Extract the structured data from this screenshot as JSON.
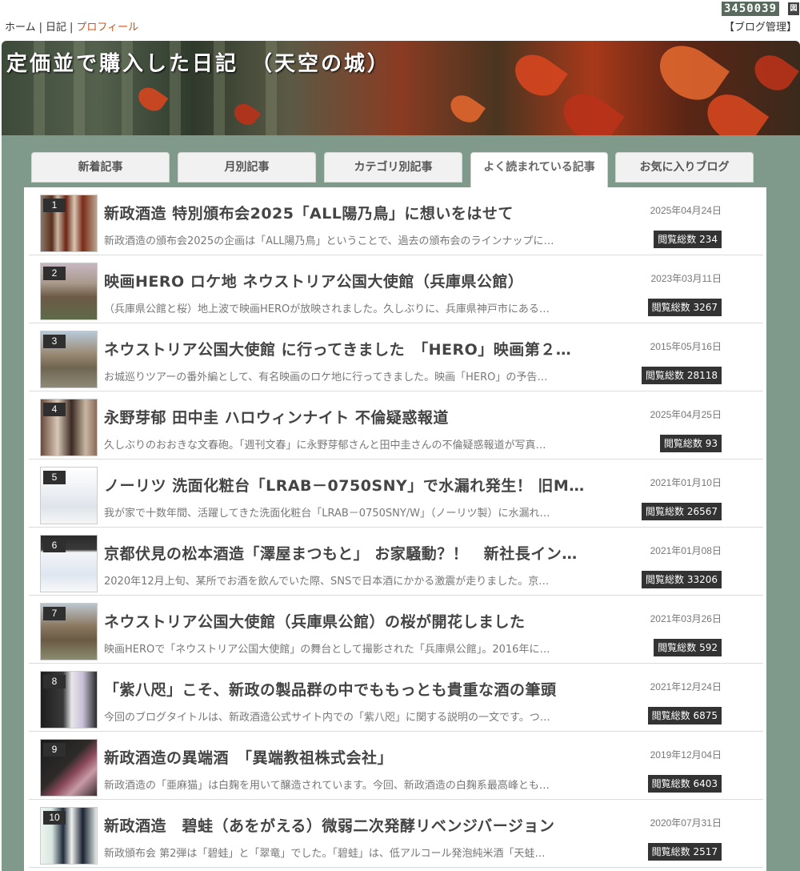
{
  "counter": {
    "value": "3450039",
    "icon": "calendar-icon",
    "icon_glyph": "図"
  },
  "nav": {
    "home": "ホーム",
    "diary": "日記",
    "profile": "プロフィール",
    "sep": "|",
    "admin": "【ブログ管理】"
  },
  "header": {
    "title": "定価並で購入した日記　（天空の城）"
  },
  "tabs": [
    "新着記事",
    "月別記事",
    "カテゴリ別記事",
    "よく読まれている記事",
    "お気に入りブログ"
  ],
  "active_tab": 3,
  "colors": {
    "accent": "#c8541a",
    "panel_bg": "#7f9a8b",
    "badge_bg": "#333333"
  },
  "articles": [
    {
      "rank": "1",
      "title": "新政酒造 特別頒布会2025「ALL陽乃鳥」に想いをはせて",
      "excerpt": "新政酒造の頒布会2025の企画は「ALL陽乃鳥」ということで、過去の頒布会のラインナップに…",
      "date": "2025年04月24日",
      "views": "閲覧総数 234"
    },
    {
      "rank": "2",
      "title": "映画HERO ロケ地 ネウストリア公国大使館（兵庫県公館）",
      "excerpt": "（兵庫県公館と桜）地上波で映画HEROが放映されました。久しぶりに、兵庫県神戸市にある…",
      "date": "2023年03月11日",
      "views": "閲覧総数 3267"
    },
    {
      "rank": "3",
      "title": "ネウストリア公国大使館 に行ってきました　「HERO」映画第２…",
      "excerpt": "お城巡りツアーの番外編として、有名映画のロケ地に行ってきました。映画「HERO」の予告…",
      "date": "2015年05月16日",
      "views": "閲覧総数 28118"
    },
    {
      "rank": "4",
      "title": "永野芽郁 田中圭 ハロウィンナイト 不倫疑惑報道",
      "excerpt": "久しぶりのおおきな文春砲。「週刊文春」に永野芽郁さんと田中圭さんの不倫疑惑報道が写真…",
      "date": "2025年04月25日",
      "views": "閲覧総数 93"
    },
    {
      "rank": "5",
      "title": "ノーリツ 洗面化粧台「LRAB－0750SNY」で水漏れ発生！ 旧M…",
      "excerpt": "我が家で十数年間、活躍してきた洗面化粧台「LRAB－0750SNY/W」（ノーリツ製）に水漏れ…",
      "date": "2021年01月10日",
      "views": "閲覧総数 26567"
    },
    {
      "rank": "6",
      "title": "京都伏見の松本酒造「澤屋まつもと」 お家騒動？！　新社長イン…",
      "excerpt": "2020年12月上旬、某所でお酒を飲んでいた際、SNSで日本酒にかかる激震が走りました。京…",
      "date": "2021年01月08日",
      "views": "閲覧総数 33206"
    },
    {
      "rank": "7",
      "title": "ネウストリア公国大使館（兵庫県公館）の桜が開花しました",
      "excerpt": "映画HEROで「ネウストリア公国大使館」の舞台として撮影された「兵庫県公館」。2016年に…",
      "date": "2021年03月26日",
      "views": "閲覧総数 592"
    },
    {
      "rank": "8",
      "title": "「紫八咫」こそ、新政の製品群の中でももっとも貴重な酒の筆頭",
      "excerpt": "今回のブログタイトルは、新政酒造公式サイト内での「紫八咫」に関する説明の一文です。つ…",
      "date": "2021年12月24日",
      "views": "閲覧総数 6875"
    },
    {
      "rank": "9",
      "title": "新政酒造の異端酒　「異端教祖株式会社」",
      "excerpt": "新政酒造の「亜麻猫」は白麹を用いて醸造されています。今回、新政酒造の白麹系最高峰とも…",
      "date": "2019年12月04日",
      "views": "閲覧総数 6403"
    },
    {
      "rank": "10",
      "title": "新政酒造　碧蛙（あをがえる）微弱二次発酵リベンジバージョン",
      "excerpt": "新政頒布会 第2弾は「碧蛙」と「翠竜」でした。「碧蛙」は、低アルコール発泡純米酒「天蛙…",
      "date": "2020年07月31日",
      "views": "閲覧総数 2517"
    }
  ]
}
